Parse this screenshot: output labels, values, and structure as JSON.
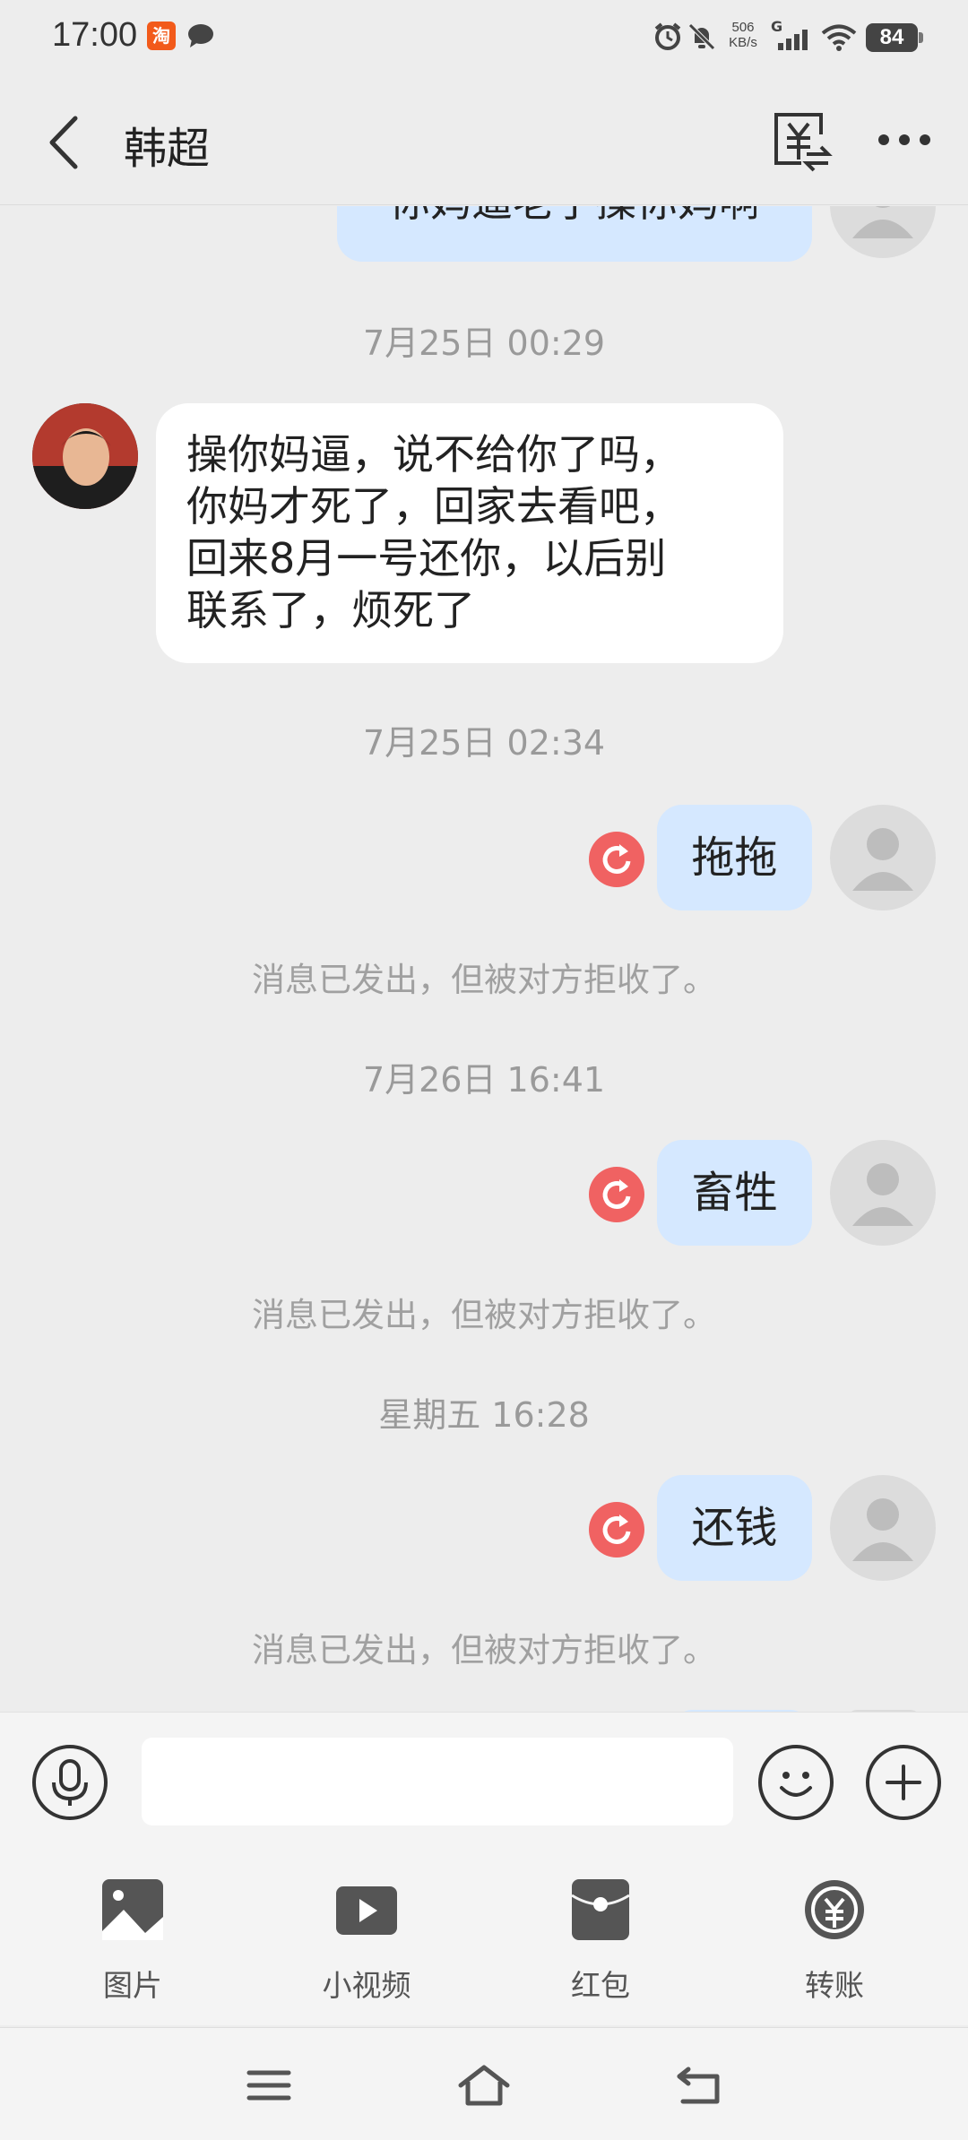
{
  "status_bar": {
    "time": "17:00",
    "taobao_glyph": "淘",
    "net_speed_value": "506",
    "net_speed_unit": "KB/s",
    "signal_label": "G",
    "battery": "84",
    "icons": [
      "taobao-icon",
      "message-icon",
      "alarm-icon",
      "mute-icon",
      "signal-icon",
      "wifi-icon",
      "battery-icon"
    ]
  },
  "header": {
    "title": "韩超",
    "icons": [
      "back-icon",
      "yuan-transfer-icon",
      "more-icon"
    ]
  },
  "messages": {
    "partial_top": {
      "text": "你妈逼老子操你妈啊"
    },
    "ts1": "7月25日 00:29",
    "incoming1": {
      "lines": [
        "操你妈逼，说不给你了吗，",
        "你妈才死了，回家去看吧，",
        "回来8月一号还你，以后别",
        "联系了，烦死了"
      ]
    },
    "ts2": "7月25日 02:34",
    "out1": {
      "text": "拖拖"
    },
    "notice1": "消息已发出，但被对方拒收了。",
    "ts3": "7月26日 16:41",
    "out2": {
      "text": "畜牲"
    },
    "notice2": "消息已发出，但被对方拒收了。",
    "ts4": "星期五 16:28",
    "out3": {
      "text": "还钱"
    },
    "notice3": "消息已发出，但被对方拒收了。"
  },
  "input_bar": {
    "value": "",
    "placeholder": "",
    "icons": [
      "microphone-icon",
      "emoji-icon",
      "plus-icon"
    ]
  },
  "tools": [
    {
      "label": "图片",
      "icon": "image-icon"
    },
    {
      "label": "小视频",
      "icon": "video-icon"
    },
    {
      "label": "红包",
      "icon": "red-packet-icon"
    },
    {
      "label": "转账",
      "icon": "transfer-icon"
    }
  ],
  "nav": {
    "icons": [
      "menu-icon",
      "home-icon",
      "back-nav-icon"
    ]
  },
  "colors": {
    "background": "#ededed",
    "outgoing_bubble": "#d5e8ff",
    "incoming_bubble": "#ffffff",
    "resend_red": "#f06262",
    "muted_text": "#9a9a9a"
  }
}
